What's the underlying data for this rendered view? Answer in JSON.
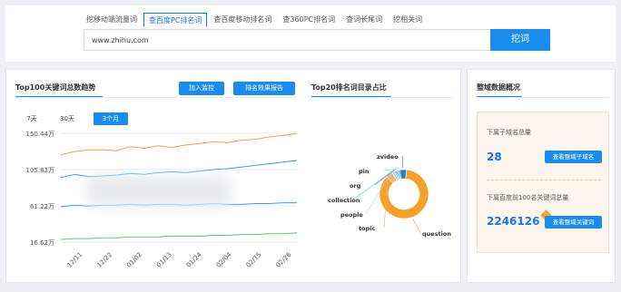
{
  "search": {
    "tabs": [
      "挖移动端流量词",
      "查百度PC排名词",
      "查百度移动排名词",
      "查360PC排名词",
      "查词长尾词",
      "挖相关词"
    ],
    "active_tab": 1,
    "input_value": "www.zhihu.com",
    "button_label": "挖词"
  },
  "trend_panel": {
    "title": "Top100关键词总数趋势",
    "add_monitor_label": "加入监控",
    "report_label": "排名效果报告",
    "ranges": [
      "7天",
      "30天",
      "3个月"
    ],
    "active_range": 2
  },
  "pie_panel": {
    "title": "Top20排名词目录占比"
  },
  "overview": {
    "title": "整域数据概况",
    "subdomain_label": "下属子域名总量",
    "subdomain_value": "28",
    "subdomain_button": "查看整域子域名",
    "keyword_label": "下属百度前100名关键词总量",
    "keyword_value": "2246126",
    "keyword_button": "查看整域关键词"
  },
  "colors": {
    "accent": "#1a8cf0",
    "orange": "#f0a04b",
    "blue": "#3a9ee6",
    "green": "#5cc96b"
  },
  "chart_data": [
    {
      "type": "line",
      "title": "Top100关键词总数趋势",
      "y_tick_labels": [
        "150.44万",
        "105.83万",
        "61.22万",
        "16.62万"
      ],
      "ylim": [
        16.62,
        150.44
      ],
      "y_unit": "万",
      "x_tick_labels": [
        "12/11",
        "12/22",
        "01/02",
        "01/13",
        "01/24",
        "02/04",
        "02/15",
        "02/26"
      ],
      "grid": true,
      "series": [
        {
          "values": [
            124,
            128,
            130,
            130,
            129,
            134,
            132,
            135,
            133,
            136,
            138,
            140,
            139,
            142,
            143,
            146,
            148,
            150
          ]
        },
        {
          "values": [
            96,
            100,
            97,
            98,
            99,
            101,
            100,
            102,
            103,
            102,
            104,
            106,
            107,
            109,
            111,
            113,
            115,
            117
          ]
        },
        {
          "values": [
            60,
            62,
            61,
            62,
            62,
            63,
            62,
            63,
            63,
            62,
            63,
            64,
            63,
            63,
            64,
            64,
            65,
            65
          ]
        },
        {
          "values": [
            20,
            21,
            21,
            22,
            22,
            23,
            23,
            23,
            24,
            24,
            24,
            25,
            25,
            26,
            26,
            27,
            27,
            28
          ]
        }
      ]
    },
    {
      "type": "pie",
      "title": "Top20排名词目录占比",
      "slices": [
        {
          "label": "question",
          "value": 86
        },
        {
          "label": "topic",
          "value": 4.5
        },
        {
          "label": "people",
          "value": 1.5
        },
        {
          "label": "collection",
          "value": 1
        },
        {
          "label": "org",
          "value": 1
        },
        {
          "label": "pin",
          "value": 1.5
        },
        {
          "label": "zvideo",
          "value": 4.5
        }
      ]
    }
  ]
}
